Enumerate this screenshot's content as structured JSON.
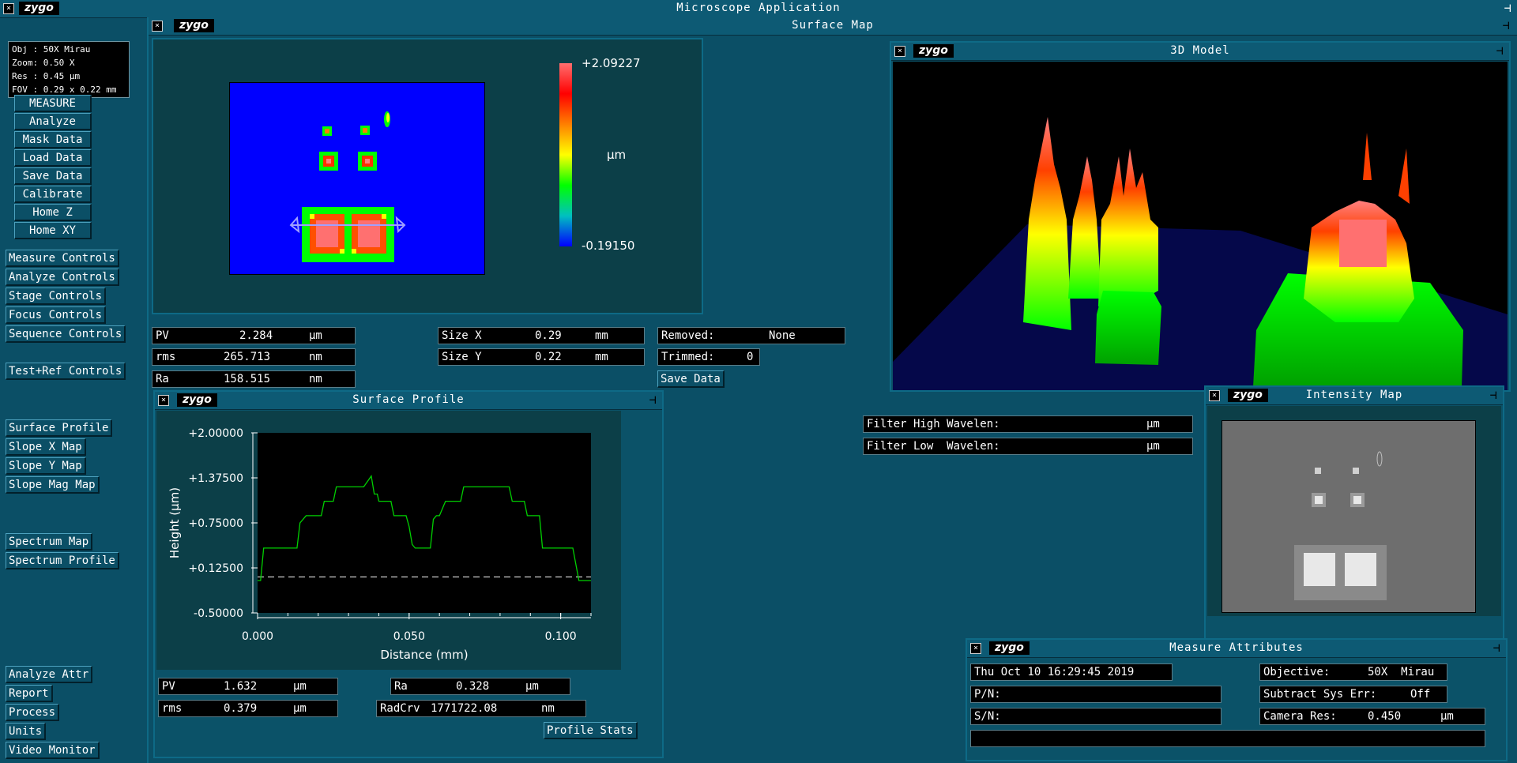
{
  "app": {
    "title": "Microscope Application",
    "logo": "zygo"
  },
  "info": {
    "obj": "Obj : 50X  Mirau",
    "zoom": "Zoom: 0.50 X",
    "res": "Res : 0.45 µm",
    "fov": "FOV : 0.29 x 0.22 mm"
  },
  "main_buttons": [
    "MEASURE",
    "Analyze",
    "Mask Data",
    "Load Data",
    "Save Data",
    "Calibrate",
    "Home Z",
    "Home XY"
  ],
  "control_buttons": [
    "Measure Controls",
    "Analyze Controls",
    "Stage Controls",
    "Focus Controls",
    "Sequence Controls"
  ],
  "testref_button": "Test+Ref Controls",
  "map_buttons": [
    "Surface Profile",
    "Slope X Map",
    "Slope Y Map",
    "Slope Mag Map"
  ],
  "spectrum_buttons": [
    "Spectrum Map",
    "Spectrum Profile"
  ],
  "bottom_buttons": [
    "Analyze Attr",
    "Report",
    "Process",
    "Units",
    "Video Monitor"
  ],
  "surface_map": {
    "title": "Surface Map",
    "colorbar_max": "+2.09227",
    "colorbar_min": "-0.19150",
    "colorbar_unit": "µm",
    "colorbar_colors": [
      "#ff6e6e",
      "#ff0000",
      "#ff8000",
      "#ffff00",
      "#00ff00",
      "#00c0c0",
      "#0000ff"
    ],
    "stats": {
      "pv": {
        "label": "PV",
        "value": "2.284",
        "unit": "µm"
      },
      "rms": {
        "label": "rms",
        "value": "265.713",
        "unit": "nm"
      },
      "ra": {
        "label": "Ra",
        "value": "158.515",
        "unit": "nm"
      },
      "size_x": {
        "label": "Size X",
        "value": "0.29",
        "unit": "mm"
      },
      "size_y": {
        "label": "Size Y",
        "value": "0.22",
        "unit": "mm"
      },
      "removed": {
        "label": "Removed:",
        "value": "None"
      },
      "trimmed": {
        "label": "Trimmed:",
        "value": "0"
      },
      "save_button": "Save Data"
    }
  },
  "model_3d": {
    "title": "3D Model"
  },
  "surface_profile": {
    "title": "Surface Profile",
    "stats": {
      "pv": {
        "label": "PV",
        "value": "1.632",
        "unit": "µm"
      },
      "rms": {
        "label": "rms",
        "value": "0.379",
        "unit": "µm"
      },
      "ra": {
        "label": "Ra",
        "value": "0.328",
        "unit": "µm"
      },
      "radcrv": {
        "label": "RadCrv",
        "value": "1771722.08",
        "unit": "nm"
      },
      "profile_stats_button": "Profile Stats"
    }
  },
  "filters": {
    "high": {
      "label": "Filter High Wavelen:",
      "unit": "µm"
    },
    "low": {
      "label": "Filter Low  Wavelen:",
      "unit": "µm"
    }
  },
  "intensity_map": {
    "title": "Intensity Map"
  },
  "measure_attributes": {
    "title": "Measure Attributes",
    "datetime": "Thu Oct 10 16:29:45 2019",
    "pn_label": "P/N:",
    "sn_label": "S/N:",
    "objective_label": "Objective:",
    "objective_value": "50X  Mirau",
    "subtract_label": "Subtract Sys Err:",
    "subtract_value": "Off",
    "camera_label": "Camera Res:",
    "camera_value": "0.450",
    "camera_unit": "µm"
  },
  "chart_data": {
    "type": "line",
    "title": "",
    "xlabel": "Distance (mm)",
    "ylabel": "Height (µm)",
    "xlim": [
      0.0,
      0.11
    ],
    "ylim": [
      -0.5,
      2.0
    ],
    "x_ticks": [
      "0.000",
      "0.050",
      "0.100"
    ],
    "y_ticks": [
      "+2.00000",
      "+1.37500",
      "+0.75000",
      "+0.12500",
      "-0.50000"
    ],
    "reference_line_y": 0.0,
    "series": [
      {
        "color": "#00d000",
        "x": [
          0.0,
          0.001,
          0.002,
          0.003,
          0.013,
          0.014,
          0.016,
          0.021,
          0.022,
          0.025,
          0.026,
          0.029,
          0.03,
          0.034,
          0.035,
          0.0375,
          0.0385,
          0.0395,
          0.04,
          0.044,
          0.045,
          0.049,
          0.05,
          0.051,
          0.052,
          0.057,
          0.058,
          0.059,
          0.06,
          0.0615,
          0.062,
          0.067,
          0.068,
          0.071,
          0.072,
          0.083,
          0.084,
          0.088,
          0.089,
          0.093,
          0.094,
          0.103,
          0.104,
          0.106,
          0.107,
          0.11
        ],
        "y": [
          -0.05,
          -0.05,
          0.4,
          0.4,
          0.4,
          0.75,
          0.85,
          0.85,
          1.05,
          1.05,
          1.25,
          1.25,
          1.25,
          1.25,
          1.25,
          1.4,
          1.15,
          1.15,
          1.05,
          1.05,
          0.85,
          0.85,
          0.7,
          0.45,
          0.4,
          0.4,
          0.8,
          0.85,
          0.85,
          1.0,
          1.05,
          1.05,
          1.25,
          1.25,
          1.25,
          1.25,
          1.05,
          1.05,
          0.85,
          0.85,
          0.4,
          0.4,
          0.4,
          -0.05,
          -0.05,
          -0.05
        ]
      }
    ]
  }
}
